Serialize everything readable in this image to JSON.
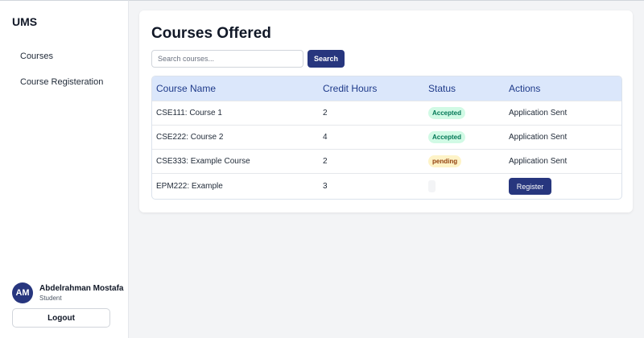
{
  "sidebar": {
    "brand": "UMS",
    "nav": [
      {
        "label": "Courses"
      },
      {
        "label": "Course Registeration"
      }
    ],
    "user": {
      "initials": "AM",
      "name": "Abdelrahman Mostafa",
      "role": "Student"
    },
    "logout_label": "Logout"
  },
  "main": {
    "title": "Courses Offered",
    "search": {
      "placeholder": "Search courses...",
      "value": "",
      "button_label": "Search"
    },
    "table": {
      "headers": [
        "Course Name",
        "Credit Hours",
        "Status",
        "Actions"
      ],
      "rows": [
        {
          "name": "CSE111: Course 1",
          "hours": "2",
          "status": "Accepted",
          "action": "Application Sent"
        },
        {
          "name": "CSE222: Course 2",
          "hours": "4",
          "status": "Accepted",
          "action": "Application Sent"
        },
        {
          "name": "CSE333: Example Course",
          "hours": "2",
          "status": "pending",
          "action": "Application Sent"
        },
        {
          "name": "EPM222: Example",
          "hours": "3",
          "status": "",
          "action": "Register"
        }
      ]
    }
  },
  "colors": {
    "primary": "#27367e",
    "table_header_bg": "#dbe7fb",
    "accepted_bg": "#d1fae5",
    "accepted_text": "#047857",
    "pending_bg": "#fef3c7",
    "pending_text": "#92400e"
  }
}
